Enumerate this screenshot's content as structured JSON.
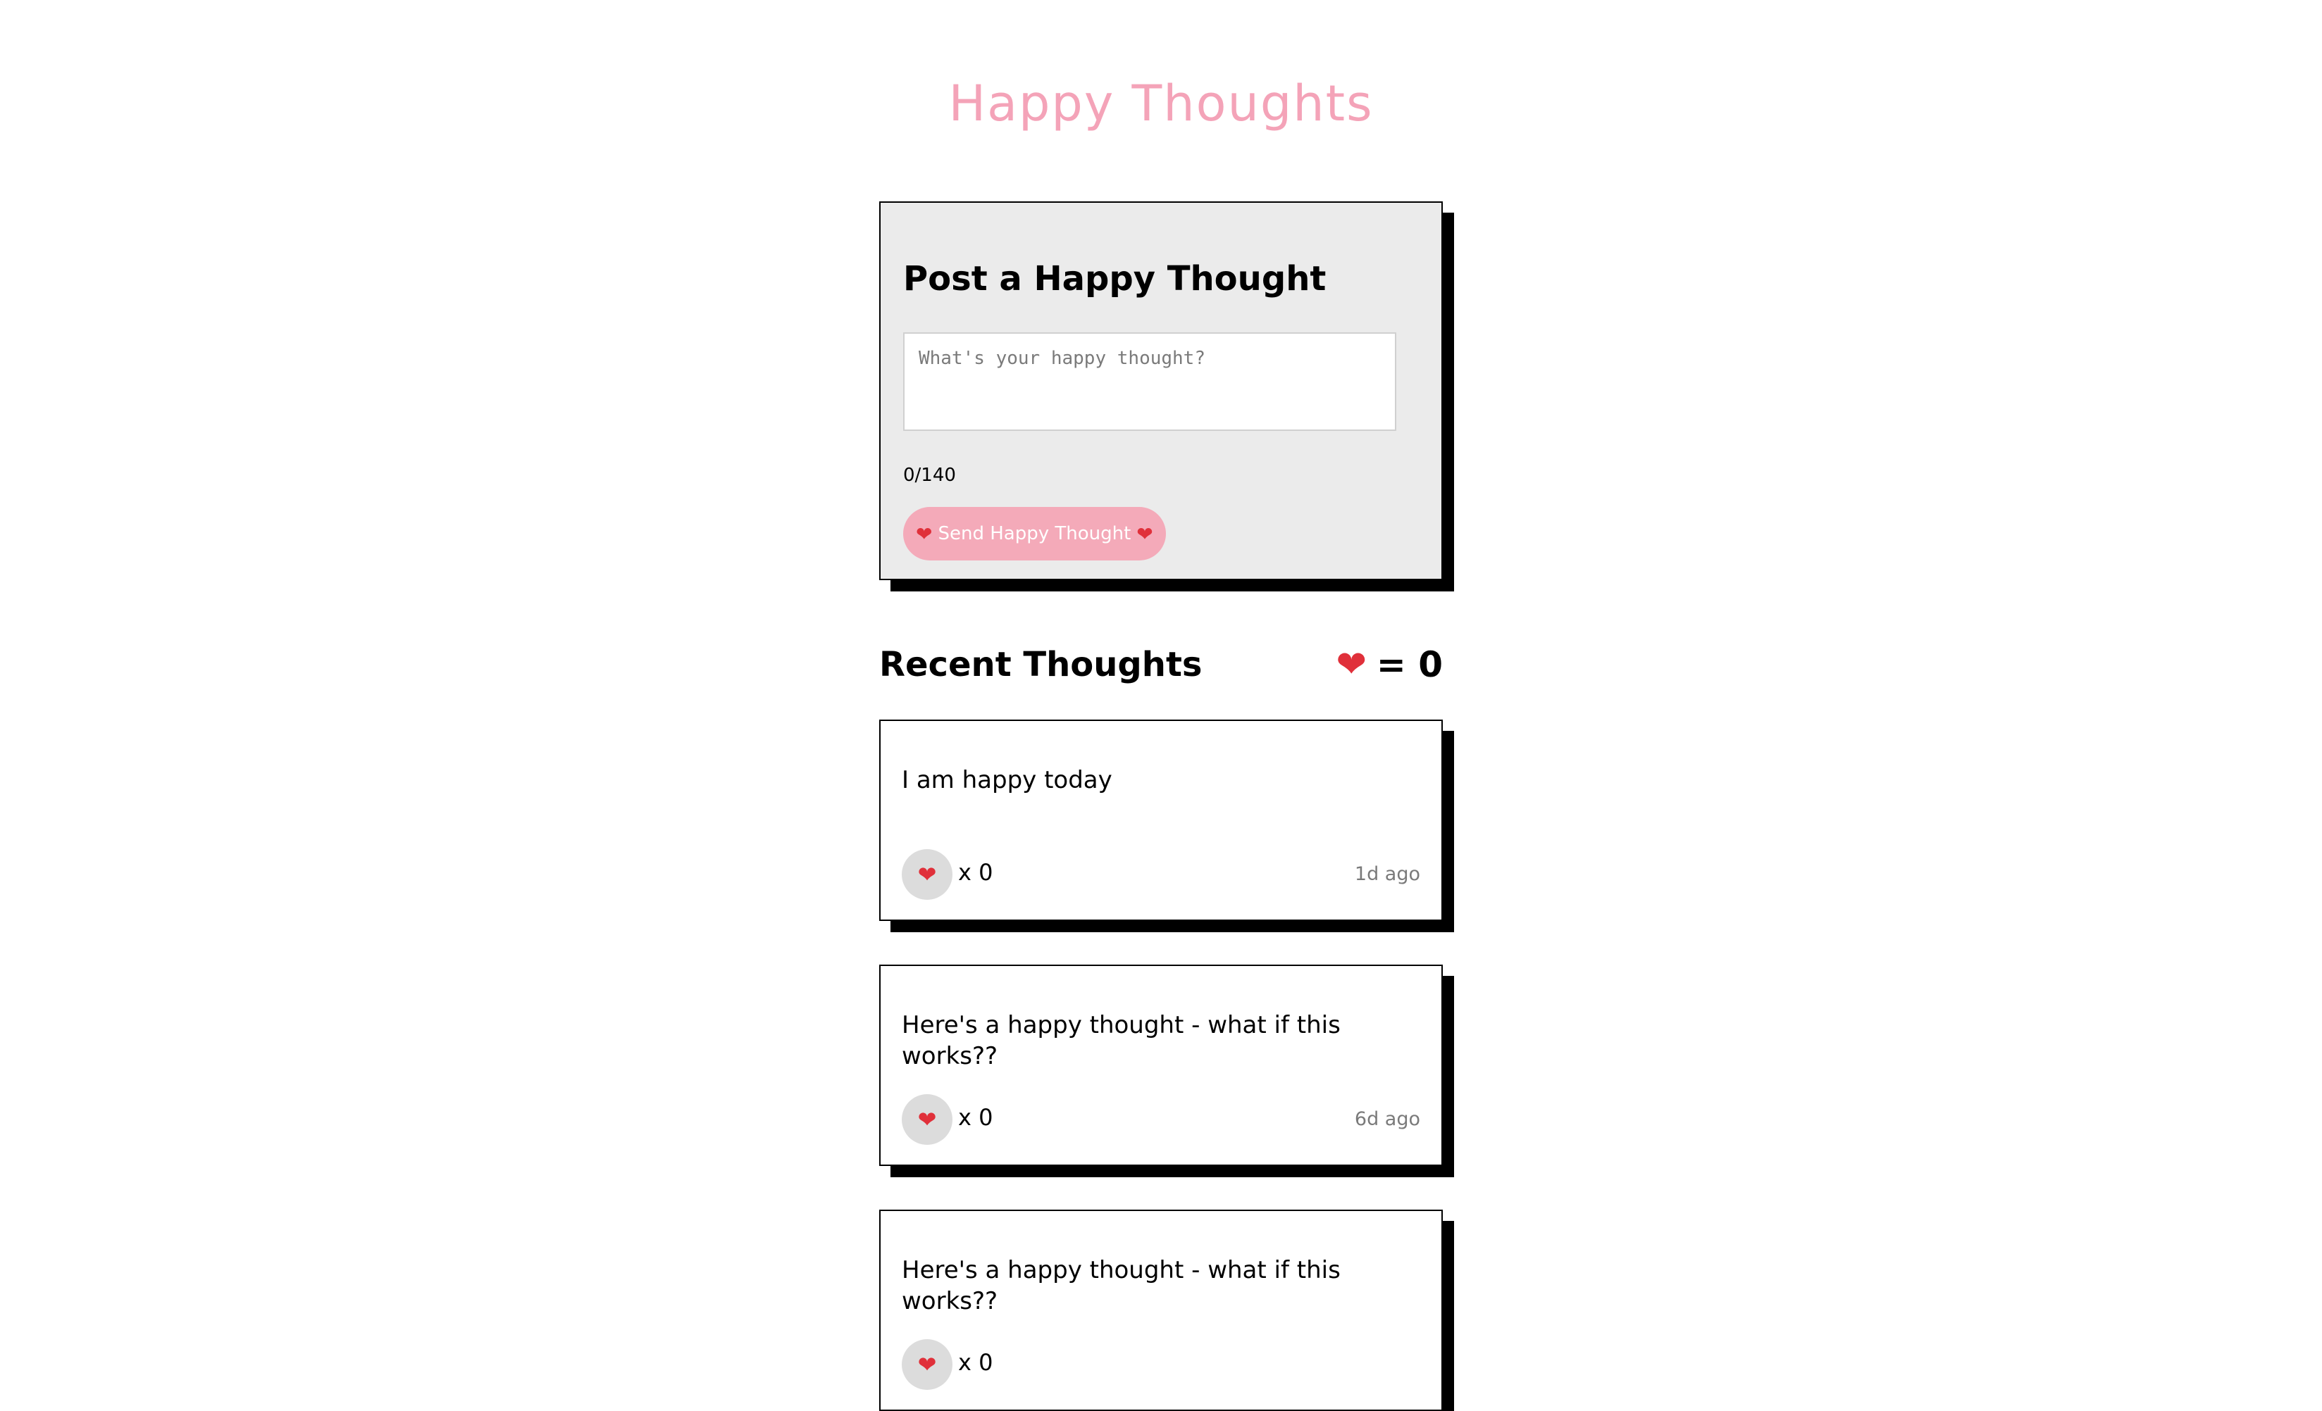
{
  "app": {
    "title": "Happy Thoughts"
  },
  "form": {
    "heading": "Post a Happy Thought",
    "input_placeholder": "What's your happy thought?",
    "input_value": "",
    "char_count": "0/140",
    "send_label": "Send Happy Thought",
    "send_icon": "heart-icon"
  },
  "recent": {
    "title": "Recent Thoughts",
    "total_likes_label": "= 0",
    "total_likes_icon": "heart-icon"
  },
  "thoughts": [
    {
      "message": "I am happy today",
      "likes": "x 0",
      "time": "1d ago"
    },
    {
      "message": "Here's a happy thought - what if this works??",
      "likes": "x 0",
      "time": "6d ago"
    },
    {
      "message": "Here's a happy thought - what if this works??",
      "likes": "x 0",
      "time": ""
    }
  ],
  "colors": {
    "title_pink": "#f4a3b8",
    "button_pink": "#f4aab9",
    "card_gray": "#ebebeb",
    "heart_red": "#e0303a",
    "like_button_gray": "#dcdcdc",
    "shadow": "#000000"
  }
}
